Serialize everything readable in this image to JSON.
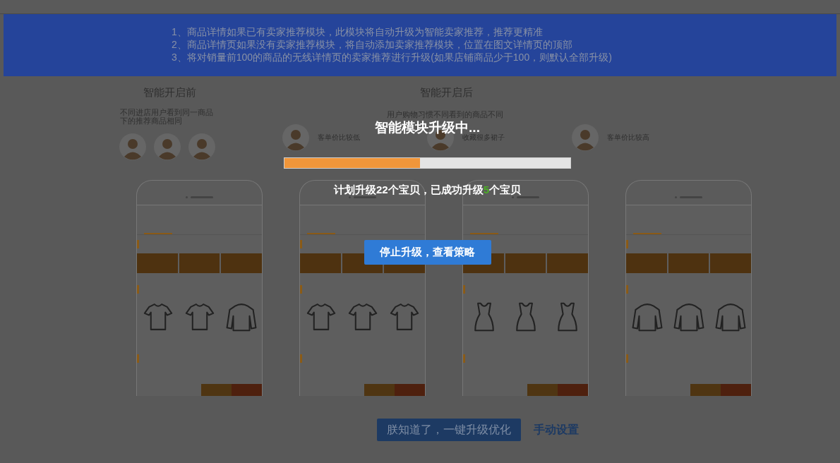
{
  "banner": {
    "lines": [
      "1、商品详情如果已有卖家推荐模块，此模块将自动升级为智能卖家推荐，推荐更精准",
      "2、商品详情页如果没有卖家推荐模块，将自动添加卖家推荐模块，位置在图文详情页的顶部",
      "3、将对销量前100的商品的无线详情页的卖家推荐进行升级(如果店铺商品少于100，则默认全部升级)"
    ]
  },
  "before": {
    "title": "智能开启前",
    "subtitle": "不同进店用户看到同一商品下的推荐商品相同",
    "avatars": [
      {
        "kind": "person"
      },
      {
        "kind": "person"
      },
      {
        "kind": "person"
      }
    ]
  },
  "after": {
    "title": "智能开启后",
    "subtitle": "用户购物习惯不同看到的商品不同",
    "users": [
      {
        "label": "客单价比较低"
      },
      {
        "label": "收藏很多裙子"
      },
      {
        "label": "客单价比较高"
      }
    ]
  },
  "phones": [
    {
      "products": [
        {
          "kind": "tshirt"
        },
        {
          "kind": "tshirt"
        },
        {
          "kind": "jacket"
        }
      ]
    },
    {
      "products": [
        {
          "kind": "tshirt"
        },
        {
          "kind": "tshirt"
        },
        {
          "kind": "tshirt"
        }
      ]
    },
    {
      "products": [
        {
          "kind": "dress"
        },
        {
          "kind": "dress"
        },
        {
          "kind": "dress"
        }
      ]
    },
    {
      "products": [
        {
          "kind": "jacket"
        },
        {
          "kind": "jacket"
        },
        {
          "kind": "jacket"
        }
      ]
    }
  ],
  "modal": {
    "title": "智能模块升级中...",
    "level": 0.475,
    "status_before": "计划升级22个宝贝，已成功升级",
    "status_count": "5",
    "status_after": "个宝贝",
    "button": "停止升级，查看策略"
  },
  "footer": {
    "primary_button": "朕知道了，一键升级优化",
    "link": "手动设置"
  }
}
